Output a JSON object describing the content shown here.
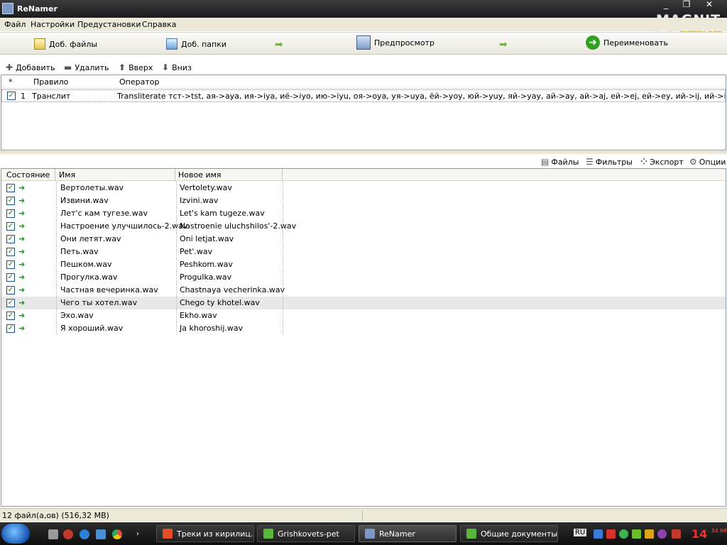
{
  "window": {
    "title": "ReNamer",
    "brand": "MAGNIT-LA",
    "brand_sub": "ReNamer Team",
    "controls": {
      "minimize": "_",
      "restore": "❐",
      "close": "✕"
    }
  },
  "menu": [
    "Файл",
    "Настройки",
    "Предустановки",
    "Справка"
  ],
  "toolbar": {
    "add_files": "Доб. файлы",
    "add_folders": "Доб. папки",
    "preview": "Предпросмотр",
    "rename": "Переименовать"
  },
  "rules_toolbar": {
    "add": "Добавить",
    "remove": "Удалить",
    "up": "Вверх",
    "down": "Вниз"
  },
  "rules": {
    "columns": [
      "*",
      "Правило",
      "Оператор"
    ],
    "rows": [
      {
        "checked": true,
        "index": "1",
        "rule": "Транслит",
        "operator": "Transliterate тст->tst, ая->aya, ия->iya, иё->iyo, ию->iyu, оя->oya, уя->uya, ёй->yoy, юй->yuy, яй->yay, ай->ay, ай->aj, ей->ej, ей->ey, ий->ij, ий->iy, ой->oj, ой->oy, уй-..."
      }
    ]
  },
  "files_toolbar": {
    "files": "Файлы",
    "filters": "Фильтры",
    "export": "Экспорт",
    "options": "Опции"
  },
  "files": {
    "columns": [
      "Состояние",
      "Имя",
      "Новое имя"
    ],
    "rows": [
      {
        "name": "Вертолеты.wav",
        "new_name": "Vertolety.wav",
        "checked": true,
        "selected": false
      },
      {
        "name": "Извини.wav",
        "new_name": "Izvini.wav",
        "checked": true,
        "selected": false
      },
      {
        "name": "Лет'с кам тугезе.wav",
        "new_name": "Let's kam tugeze.wav",
        "checked": true,
        "selected": false
      },
      {
        "name": "Настроение улучшилось-2.wav",
        "new_name": "Nastroenie uluchshilos'-2.wav",
        "checked": true,
        "selected": false
      },
      {
        "name": "Они летят.wav",
        "new_name": "Oni letjat.wav",
        "checked": true,
        "selected": false
      },
      {
        "name": "Петь.wav",
        "new_name": "Pet'.wav",
        "checked": true,
        "selected": false
      },
      {
        "name": "Пешком.wav",
        "new_name": "Peshkom.wav",
        "checked": true,
        "selected": false
      },
      {
        "name": "Прогулка.wav",
        "new_name": "Progulka.wav",
        "checked": true,
        "selected": false
      },
      {
        "name": "Частная вечеринка.wav",
        "new_name": "Chastnaya vecherinka.wav",
        "checked": true,
        "selected": false
      },
      {
        "name": "Чего ты хотел.wav",
        "new_name": "Chego ty khotel.wav",
        "checked": true,
        "selected": true
      },
      {
        "name": "Эхо.wav",
        "new_name": "Ekho.wav",
        "checked": true,
        "selected": false
      },
      {
        "name": "Я хороший.wav",
        "new_name": "Ja khoroshij.wav",
        "checked": true,
        "selected": false
      }
    ]
  },
  "status": {
    "text": "12 файл(а,ов) (516,32 MB)"
  },
  "taskbar": {
    "tasks": [
      {
        "label": "Треки из кирилиц...",
        "active": false,
        "color": "#e44d26"
      },
      {
        "label": "Grishkovets-pet",
        "active": false,
        "color": "#58b63a"
      },
      {
        "label": "ReNamer",
        "active": true,
        "color": "#7d98c6"
      },
      {
        "label": "Общие документы",
        "active": false,
        "color": "#58b63a"
      }
    ],
    "lang": "RU",
    "clock": "14",
    "clock_sub": "32 06"
  },
  "colors": {
    "titlebar": "#1c1c1c",
    "menubar": "#ece9d8",
    "selected_row": "#e8e8e8",
    "clock": "#ff2b2b"
  }
}
